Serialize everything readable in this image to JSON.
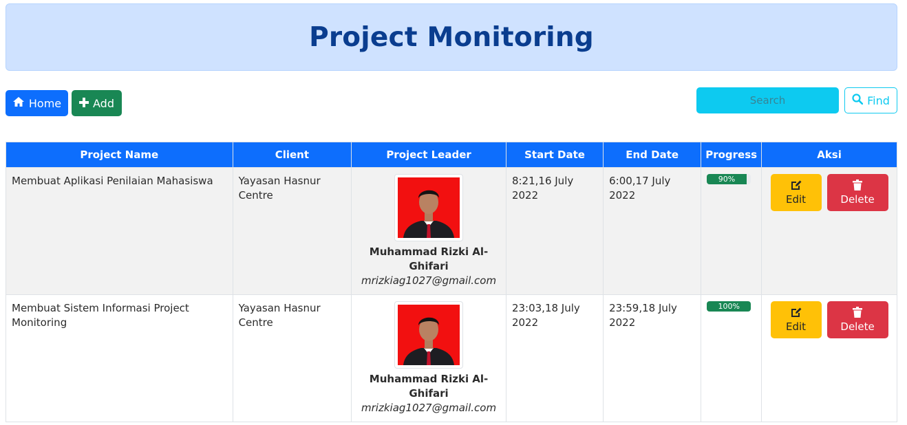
{
  "header": {
    "title": "Project Monitoring"
  },
  "toolbar": {
    "home_label": "Home",
    "add_label": "Add",
    "search_placeholder": "Search",
    "find_label": "Find"
  },
  "table": {
    "columns": [
      "Project Name",
      "Client",
      "Project Leader",
      "Start Date",
      "End Date",
      "Progress",
      "Aksi"
    ],
    "rows": [
      {
        "project_name": "Membuat Aplikasi Penilaian Mahasiswa",
        "client": "Yayasan Hasnur Centre",
        "leader_name": "Muhammad Rizki Al-Ghifari",
        "leader_email": "mrizkiag1027@gmail.com",
        "start_date": "8:21,16 July 2022",
        "end_date": "6:00,17 July 2022",
        "progress_label": "90%",
        "progress": 90,
        "edit_label": "Edit",
        "delete_label": "Delete"
      },
      {
        "project_name": "Membuat Sistem Informasi Project Monitoring",
        "client": "Yayasan Hasnur Centre",
        "leader_name": "Muhammad Rizki Al-Ghifari",
        "leader_email": "mrizkiag1027@gmail.com",
        "start_date": "23:03,18 July 2022",
        "end_date": "23:59,18 July 2022",
        "progress_label": "100%",
        "progress": 100,
        "edit_label": "Edit",
        "delete_label": "Delete"
      }
    ]
  },
  "icons": {
    "home": "home-icon",
    "add": "plus-icon",
    "find": "search-icon",
    "edit": "edit-icon",
    "delete": "trash-icon"
  },
  "colors": {
    "primary": "#0d6efd",
    "success": "#198754",
    "info": "#0dcaf0",
    "warning": "#ffc107",
    "danger": "#dc3545",
    "banner_bg": "#cfe2ff",
    "title_color": "#0a3d8f"
  }
}
